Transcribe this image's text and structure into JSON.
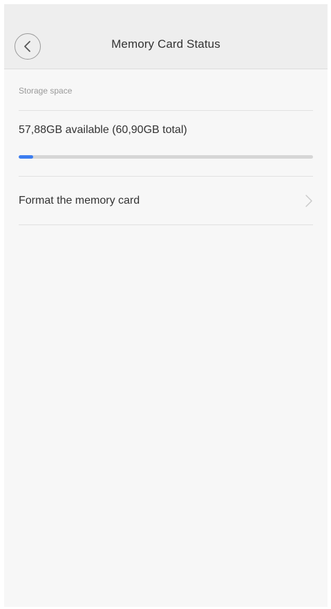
{
  "header": {
    "title": "Memory Card Status",
    "back_icon": "chevron-left-icon"
  },
  "storage": {
    "section_label": "Storage space",
    "summary": "57,88GB available (60,90GB total)",
    "used_fraction": 0.05,
    "progress_color": "#3d7ef0"
  },
  "actions": {
    "format_label": "Format the memory card",
    "format_icon": "chevron-right-icon"
  }
}
